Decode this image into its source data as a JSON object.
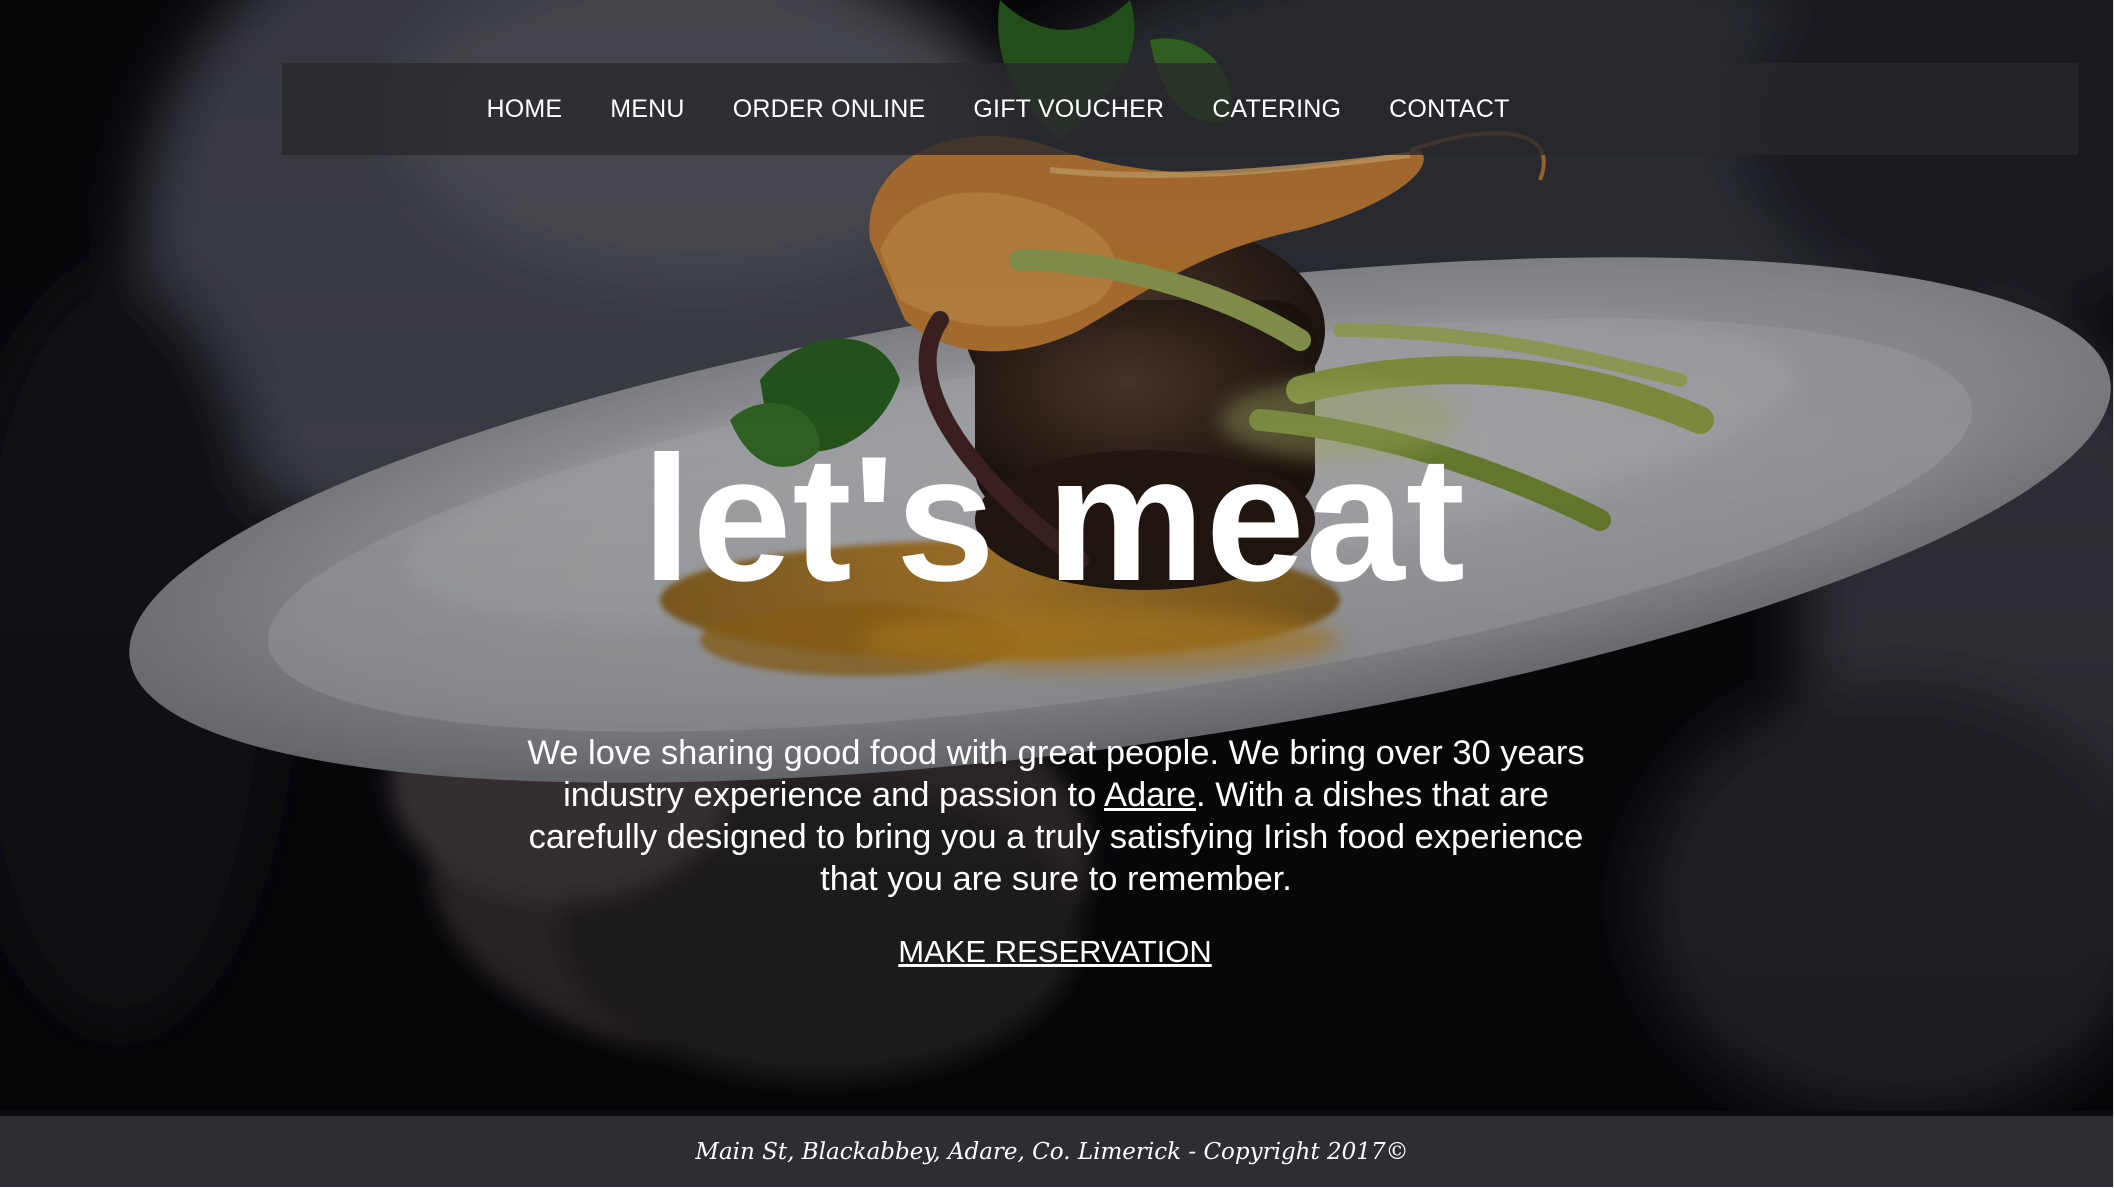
{
  "nav": {
    "items": [
      {
        "label": "HOME"
      },
      {
        "label": "MENU"
      },
      {
        "label": "ORDER ONLINE"
      },
      {
        "label": "GIFT VOUCHER"
      },
      {
        "label": "CATERING"
      },
      {
        "label": "CONTACT"
      }
    ]
  },
  "hero": {
    "title": "let's meat",
    "intro_before_link": "We love sharing good food with great people. We bring over 30 years industry experience and passion to ",
    "intro_link": "Adare",
    "intro_after_link": ". With a dishes that are carefully designed to bring you a truly satisfying Irish food experience that you are sure to remember.",
    "cta": "MAKE RESERVATION",
    "photo_icon": "plated-steak-and-prawn-photo"
  },
  "footer": {
    "text": "Main St, Blackabbey, Adare, Co. Limerick - Copyright 2017©"
  },
  "colors": {
    "nav_bar": "#28282c",
    "footer_bg": "#2d2e33",
    "text": "#ffffff"
  }
}
